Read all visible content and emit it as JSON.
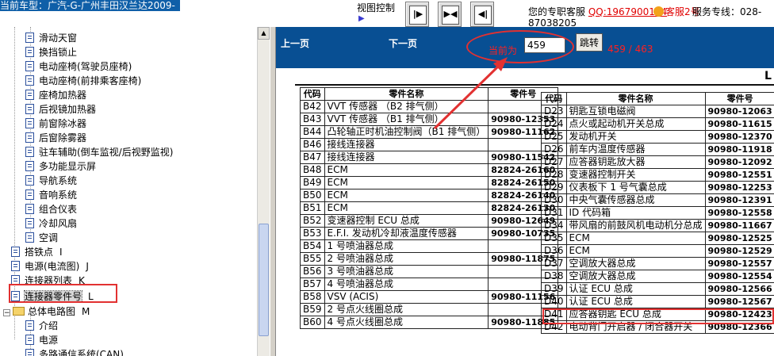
{
  "header": {
    "car_title": "当前车型：广汽-G-广州丰田汉兰达2009-",
    "view_control": "视图控制",
    "service_label": "您的专职客服",
    "qq": "QQ:1967900174",
    "kf2": "客服2号",
    "hotline": "服务专线：028-",
    "hotline2": "87038205"
  },
  "tree": {
    "items": [
      {
        "label": "滑动天窗",
        "tag": ""
      },
      {
        "label": "换挡锁止",
        "tag": ""
      },
      {
        "label": "电动座椅(驾驶员座椅)",
        "tag": ""
      },
      {
        "label": "电动座椅(前排乘客座椅)",
        "tag": ""
      },
      {
        "label": "座椅加热器",
        "tag": ""
      },
      {
        "label": "后视镜加热器",
        "tag": ""
      },
      {
        "label": "前窗除冰器",
        "tag": ""
      },
      {
        "label": "后窗除雾器",
        "tag": ""
      },
      {
        "label": "驻车辅助(倒车监视/后视野监视)",
        "tag": ""
      },
      {
        "label": "多功能显示屏",
        "tag": ""
      },
      {
        "label": "导航系统",
        "tag": ""
      },
      {
        "label": "音响系统",
        "tag": ""
      },
      {
        "label": "组合仪表",
        "tag": ""
      },
      {
        "label": "冷却风扇",
        "tag": ""
      },
      {
        "label": "空调",
        "tag": ""
      },
      {
        "label": "搭铁点",
        "tag": "I"
      },
      {
        "label": "电源(电流图)",
        "tag": "J"
      },
      {
        "label": "连接器列表",
        "tag": "K"
      },
      {
        "label": "连接器零件号",
        "tag": "L"
      },
      {
        "label": "总体电路图",
        "tag": "M"
      },
      {
        "label": "介绍",
        "tag": ""
      },
      {
        "label": "电源",
        "tag": ""
      },
      {
        "label": "多路通信系统(CAN)",
        "tag": ""
      }
    ]
  },
  "nav": {
    "prev": "上一页",
    "next": "下一页",
    "current_label": "当前为",
    "page_value": "459",
    "jump": "跳转",
    "page_count": "459 / 463"
  },
  "doc": {
    "corner": "L",
    "headers": {
      "code": "代码",
      "name": "零件名称",
      "pn": "零件号"
    },
    "left_rows": [
      {
        "code": "B42",
        "name": "VVT 传感器 （B2 排气侧）",
        "pn": ""
      },
      {
        "code": "B43",
        "name": "VVT 传感器 （B1 排气侧）",
        "pn": "90980-12353"
      },
      {
        "code": "B44",
        "name": "凸轮轴正时机油控制阀（B1 排气侧）",
        "pn": "90980-11162"
      },
      {
        "code": "B46",
        "name": "接线连接器",
        "pn": ""
      },
      {
        "code": "B47",
        "name": "接线连接器",
        "pn": "90980-11542"
      },
      {
        "code": "B48",
        "name": "ECM",
        "pn": "82824-26160"
      },
      {
        "code": "B49",
        "name": "ECM",
        "pn": "82824-26150"
      },
      {
        "code": "B50",
        "name": "ECM",
        "pn": "82824-26140"
      },
      {
        "code": "B51",
        "name": "ECM",
        "pn": "82824-26130"
      },
      {
        "code": "B52",
        "name": "变速器控制 ECU 总成",
        "pn": "90980-12649"
      },
      {
        "code": "B53",
        "name": "E.F.I. 发动机冷却液温度传感器",
        "pn": "90980-10735"
      },
      {
        "code": "B54",
        "name": "1 号喷油器总成",
        "pn": ""
      },
      {
        "code": "B55",
        "name": "2 号喷油器总成",
        "pn": "90980-11875"
      },
      {
        "code": "B56",
        "name": "3 号喷油器总成",
        "pn": ""
      },
      {
        "code": "B57",
        "name": "4 号喷油器总成",
        "pn": ""
      },
      {
        "code": "B58",
        "name": "VSV (ACIS)",
        "pn": "90980-11156"
      },
      {
        "code": "B59",
        "name": "2 号点火线圈总成",
        "pn": ""
      },
      {
        "code": "B60",
        "name": "4 号点火线圈总成",
        "pn": "90980-11885"
      }
    ],
    "right_rows": [
      {
        "code": "D23",
        "name": "钥匙互锁电磁阀",
        "pn": "90980-12063"
      },
      {
        "code": "D24",
        "name": "点火或起动机开关总成",
        "pn": "90980-11615"
      },
      {
        "code": "D25",
        "name": "发动机开关",
        "pn": "90980-12370"
      },
      {
        "code": "D26",
        "name": "前车内温度传感器",
        "pn": "90980-11918"
      },
      {
        "code": "D27",
        "name": "应答器钥匙放大器",
        "pn": "90980-12092"
      },
      {
        "code": "D28",
        "name": "变速器控制开关",
        "pn": "90980-12551"
      },
      {
        "code": "D29",
        "name": "仪表板下 1 号气囊总成",
        "pn": "90980-12253"
      },
      {
        "code": "D30",
        "name": "中央气囊传感器总成",
        "pn": "90980-12391"
      },
      {
        "code": "D31",
        "name": "ID 代码箱",
        "pn": "90980-12558"
      },
      {
        "code": "D34",
        "name": "带风扇的前鼓风机电动机分总成",
        "pn": "90980-11667"
      },
      {
        "code": "D35",
        "name": "ECM",
        "pn": "90980-12525"
      },
      {
        "code": "D36",
        "name": "ECM",
        "pn": "90980-12529"
      },
      {
        "code": "D37",
        "name": "空调放大器总成",
        "pn": "90980-12557"
      },
      {
        "code": "D38",
        "name": "空调放大器总成",
        "pn": "90980-12554"
      },
      {
        "code": "D39",
        "name": "认证 ECU 总成",
        "pn": "90980-12566"
      },
      {
        "code": "D40",
        "name": "认证 ECU 总成",
        "pn": "90980-12567"
      },
      {
        "code": "D41",
        "name": "应答器钥匙 ECU 总成",
        "pn": "90980-12423"
      },
      {
        "code": "D42",
        "name": "电动背门开启器 / 闭合器开关",
        "pn": "90980-12366"
      }
    ]
  },
  "colors": {
    "nav_bg": "#084f93",
    "title_bg": "#0f5fa8",
    "highlight": "#e23131"
  }
}
